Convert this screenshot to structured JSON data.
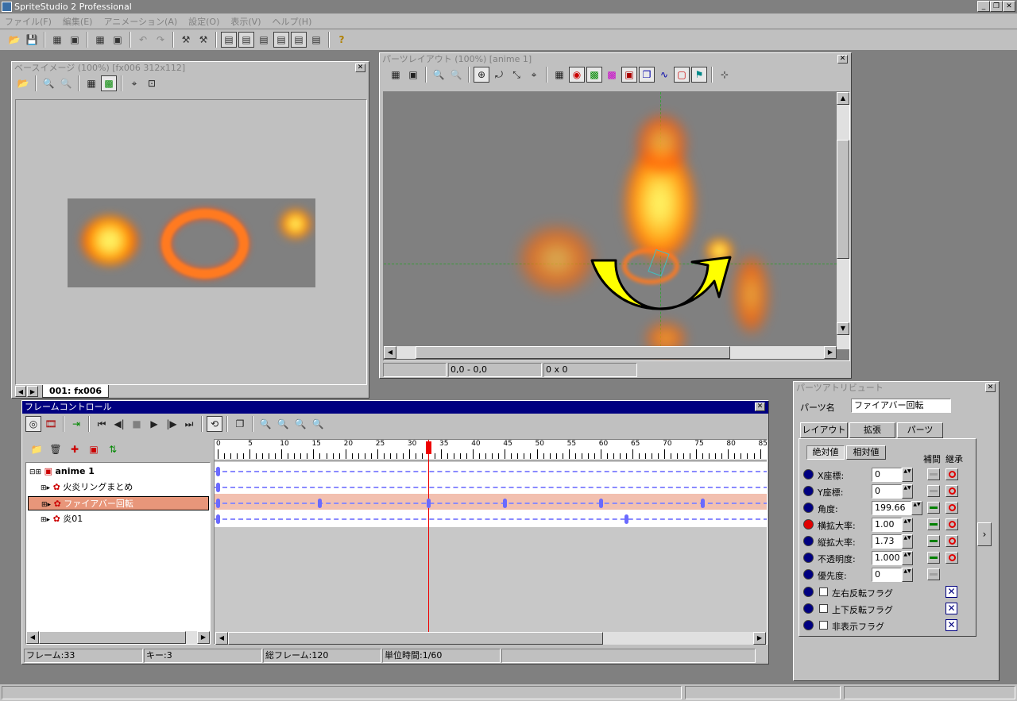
{
  "app": {
    "title": "SpriteStudio 2 Professional"
  },
  "menu": [
    "ファイル(F)",
    "編集(E)",
    "アニメーション(A)",
    "設定(O)",
    "表示(V)",
    "ヘルプ(H)"
  ],
  "base_image": {
    "title": "ベースイメージ (100%) [fx006  312x112]",
    "tab": "001: fx006"
  },
  "parts_layout": {
    "title": "パーツレイアウト (100%) [anime 1]",
    "status_pos": "0,0 - 0,0",
    "status_size": "0 x 0"
  },
  "frame_control": {
    "title": "フレームコントロール",
    "ruler": [
      "0",
      "5",
      "10",
      "15",
      "20",
      "25",
      "30",
      "35",
      "40",
      "45",
      "50",
      "55",
      "60",
      "65",
      "70",
      "75",
      "80",
      "85"
    ],
    "tree": [
      {
        "label": "anime 1",
        "bold": true
      },
      {
        "label": "火炎リングまとめ"
      },
      {
        "label": "ファイアバー回転",
        "selected": true
      },
      {
        "label": "炎01"
      }
    ],
    "status": {
      "frame": "フレーム:33",
      "key": "キー:3",
      "total": "総フレーム:120",
      "unit": "単位時間:1/60"
    }
  },
  "attributes": {
    "title": "パーツアトリビュート",
    "name_label": "パーツ名",
    "name_value": "ファイアバー回転",
    "tabs": [
      "レイアウト",
      "拡張",
      "パーツ"
    ],
    "subtabs": [
      "絶対値",
      "相対値"
    ],
    "col_interp": "補間",
    "col_inherit": "継承",
    "rows": [
      {
        "label": "X座標:",
        "value": "0"
      },
      {
        "label": "Y座標:",
        "value": "0"
      },
      {
        "label": "角度:",
        "value": "199.66"
      },
      {
        "label": "横拡大率:",
        "value": "1.00"
      },
      {
        "label": "縦拡大率:",
        "value": "1.73"
      },
      {
        "label": "不透明度:",
        "value": "1.000"
      },
      {
        "label": "優先度:",
        "value": "0"
      }
    ],
    "flags": [
      "左右反転フラグ",
      "上下反転フラグ",
      "非表示フラグ"
    ]
  }
}
